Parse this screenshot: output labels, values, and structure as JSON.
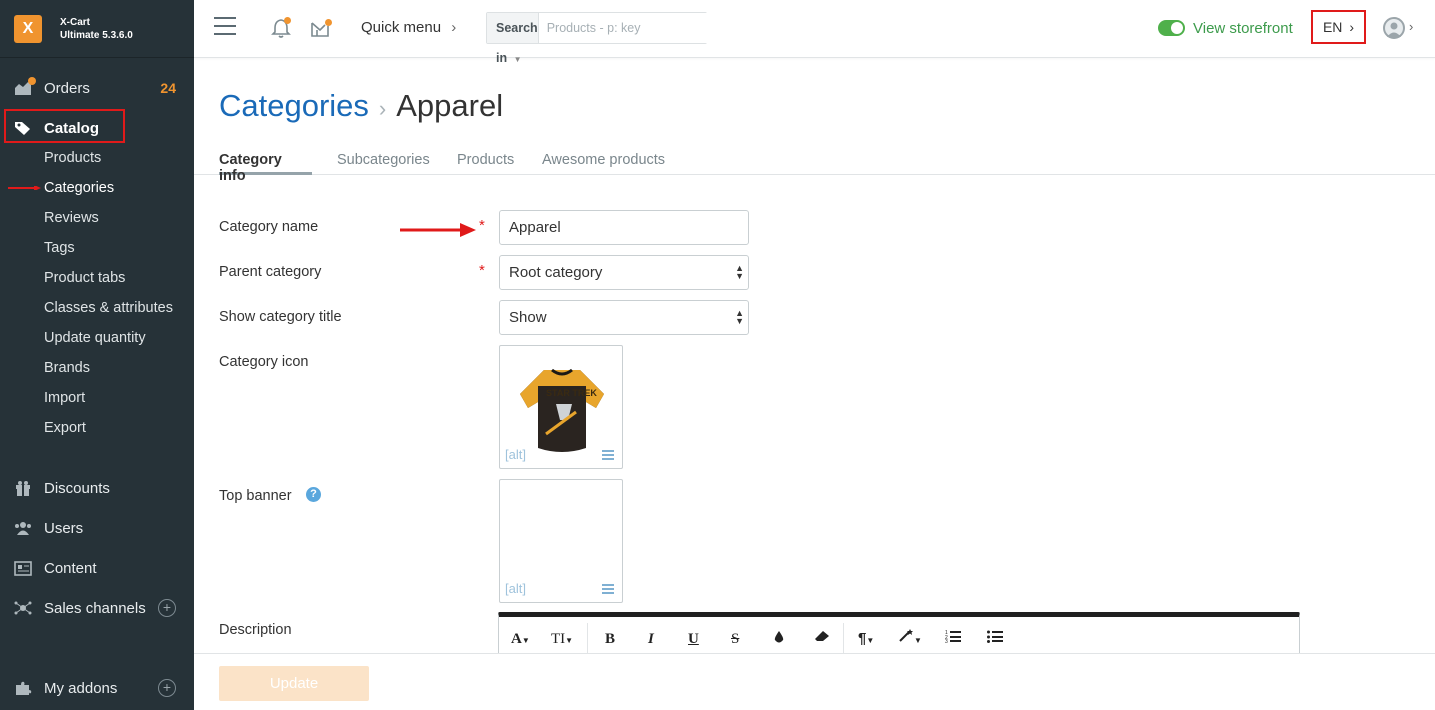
{
  "app": {
    "logo_glyph": "X",
    "name_line1": "X-Cart",
    "name_line2": "Ultimate 5.3.6.0"
  },
  "sidebar": {
    "orders": {
      "label": "Orders",
      "count": "24",
      "icon": "orders-icon"
    },
    "catalog": {
      "label": "Catalog",
      "icon": "tag-icon"
    },
    "catalog_items": [
      "Products",
      "Categories",
      "Reviews",
      "Tags",
      "Product tabs",
      "Classes & attributes",
      "Update quantity",
      "Brands",
      "Import",
      "Export"
    ],
    "discounts": {
      "label": "Discounts",
      "icon": "gift-icon"
    },
    "users": {
      "label": "Users",
      "icon": "users-icon"
    },
    "content": {
      "label": "Content",
      "icon": "content-icon"
    },
    "sales_channels": {
      "label": "Sales channels",
      "icon": "network-icon"
    },
    "my_addons": {
      "label": "My addons",
      "icon": "puzzle-icon"
    }
  },
  "header": {
    "quick_menu": "Quick menu",
    "search_in": "Search in",
    "search_placeholder": "Products - p: key",
    "view_storefront": "View storefront",
    "language": "EN",
    "chevron": "›"
  },
  "page": {
    "breadcrumb_parent": "Categories",
    "breadcrumb_sep": "›",
    "breadcrumb_current": "Apparel",
    "tabs": [
      "Category info",
      "Subcategories",
      "Products",
      "Awesome products"
    ]
  },
  "form": {
    "category_name_label": "Category name",
    "category_name_value": "Apparel",
    "parent_category_label": "Parent category",
    "parent_category_value": "Root category",
    "show_title_label": "Show category title",
    "show_title_value": "Show",
    "category_icon_label": "Category icon",
    "top_banner_label": "Top banner",
    "description_label": "Description",
    "alt_text": "[alt]",
    "required_mark": "*",
    "help_glyph": "?"
  },
  "editor_toolbar": {
    "font": "A",
    "size": "TI",
    "bold": "B",
    "italic": "I",
    "underline": "U",
    "strike": "S",
    "paragraph": "¶"
  },
  "footer": {
    "update_label": "Update"
  },
  "colors": {
    "sidebar_bg": "#263238",
    "accent_orange": "#f0942f",
    "link_blue": "#1a6ab8",
    "highlight_red": "#e01a1a",
    "storefront_green": "#3d9b4c"
  }
}
